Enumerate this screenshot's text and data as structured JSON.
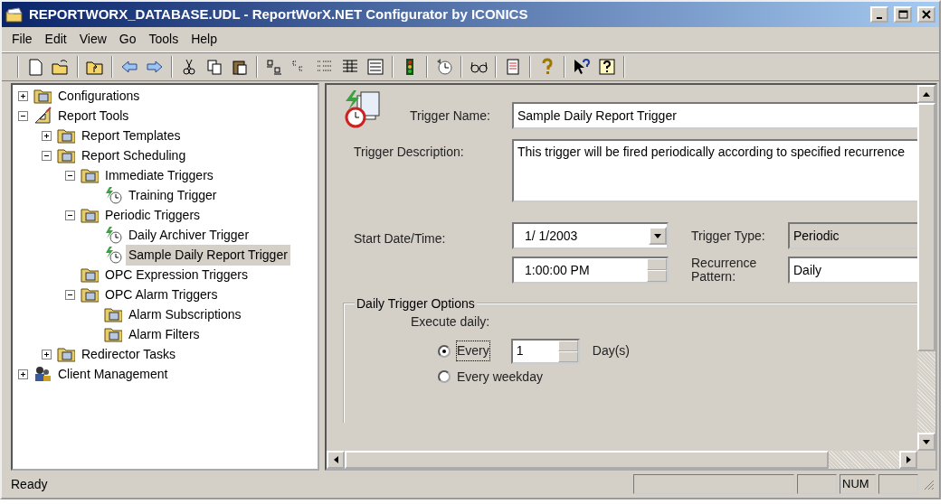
{
  "window": {
    "title": "REPORTWORX_DATABASE.UDL - ReportWorX.NET Configurator by ICONICS"
  },
  "menu": [
    "File",
    "Edit",
    "View",
    "Go",
    "Tools",
    "Help"
  ],
  "tree": [
    {
      "label": "Configurations",
      "kind": "folder",
      "expanded": false,
      "selected": false
    },
    {
      "label": "Report Tools",
      "kind": "tools",
      "expanded": true,
      "selected": false,
      "children": [
        {
          "label": "Report Templates",
          "kind": "folder",
          "expanded": false,
          "selected": false
        },
        {
          "label": "Report Scheduling",
          "kind": "folder",
          "expanded": true,
          "selected": false,
          "children": [
            {
              "label": "Immediate Triggers",
              "kind": "folder",
              "expanded": true,
              "selected": false,
              "children": [
                {
                  "label": "Training Trigger",
                  "kind": "trigger",
                  "selected": false
                }
              ]
            },
            {
              "label": "Periodic Triggers",
              "kind": "folder",
              "expanded": true,
              "selected": false,
              "children": [
                {
                  "label": "Daily Archiver Trigger",
                  "kind": "trigger",
                  "selected": false
                },
                {
                  "label": "Sample Daily Report Trigger",
                  "kind": "trigger",
                  "selected": true
                }
              ]
            },
            {
              "label": "OPC Expression Triggers",
              "kind": "folder",
              "selected": false
            },
            {
              "label": "OPC Alarm Triggers",
              "kind": "folder",
              "expanded": true,
              "selected": false,
              "children": [
                {
                  "label": "Alarm Subscriptions",
                  "kind": "folder",
                  "selected": false
                },
                {
                  "label": "Alarm Filters",
                  "kind": "folder",
                  "selected": false
                }
              ]
            }
          ]
        },
        {
          "label": "Redirector Tasks",
          "kind": "folder",
          "expanded": false,
          "selected": false
        }
      ]
    },
    {
      "label": "Client Management",
      "kind": "people",
      "expanded": false,
      "selected": false
    }
  ],
  "form": {
    "trigger_name_label": "Trigger Name:",
    "trigger_name": "Sample Daily Report Trigger",
    "description_label": "Trigger Description:",
    "description": "This trigger will be fired periodically according to specified recurrence",
    "start_label": "Start Date/Time:",
    "start_date": "1/  1/2003",
    "start_time": "1:00:00 PM",
    "type_label": "Trigger Type:",
    "trigger_type": "Periodic",
    "pattern_label": "Recurrence Pattern:",
    "recurrence_pattern": "Daily",
    "group_title": "Daily Trigger Options",
    "execute_label": "Execute daily:",
    "options": [
      {
        "label": "Every",
        "selected": true
      },
      {
        "label": "Every weekday",
        "selected": false
      }
    ],
    "interval": "1",
    "interval_unit": "Day(s)"
  },
  "status_bar": {
    "text": "Ready",
    "num_lock": "NUM"
  }
}
